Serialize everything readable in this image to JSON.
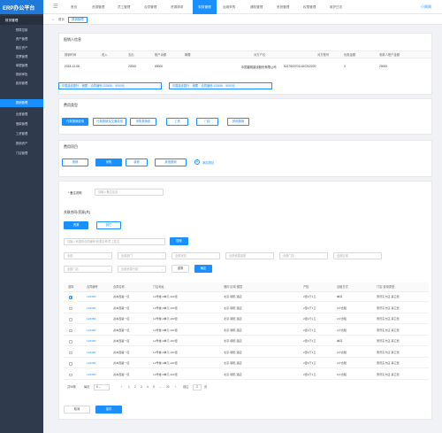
{
  "app": {
    "logo": "ERP办公平台",
    "user": "小周周"
  },
  "nav": [
    "首页",
    "资源管理",
    "员工管理",
    "合同管理",
    "资源请求",
    "财务管理",
    "运维采购",
    "通知管理",
    "系统管理",
    "权限管理",
    "维护日志"
  ],
  "sidebar": {
    "head": "财务管理",
    "items": [
      "预算控制",
      "资产管理",
      "固定资产",
      "发票管理",
      "单据管理",
      "报销审批",
      "费用管理",
      "报销管理",
      "出差管理",
      "借款管理",
      "工资管理",
      "报销资产",
      "门店管理"
    ]
  },
  "breadcrumb": {
    "home": "首页",
    "tab": "报销管理"
  },
  "summary": {
    "title": "报销人信息",
    "headers": [
      "报销时间",
      "收入",
      "支出",
      "账户余额",
      "摘要",
      "对方户名",
      "对方账号",
      "优惠金额",
      "收款人账户金额"
    ],
    "values": [
      "2018-12-08",
      "",
      "20000",
      "69000",
      "",
      "中国建筑建设股份有限公司",
      "62176007011447202200",
      "0",
      "20000"
    ],
    "tags": [
      {
        "bank": "中国建设银行",
        "type": "储蓄",
        "account": "合同编号:123456",
        "amount": "5000元"
      },
      {
        "bank": "中国建设银行",
        "type": "储蓄",
        "account": "合同编号:123456",
        "amount": "5000元"
      }
    ]
  },
  "expense_type": {
    "title": "费用类型",
    "options": [
      "代报报销费用",
      "代报报销及交通费用",
      "采购报销费",
      "工资",
      "门店",
      "其他报销"
    ]
  },
  "expense_item": {
    "title": "费用项目",
    "options": [
      "报销",
      "采购",
      "装修",
      "其他报销",
      "其他项目"
    ],
    "add_label": "添加项目"
  },
  "remark": {
    "label": "* 备注说明",
    "placeholder": "请输入备注信息"
  },
  "related": {
    "title": "关联合同/资源(共)",
    "tabs": [
      "资源",
      "其它"
    ],
    "search_placeholder": "请输入资源的合同编号/资源名称/员工姓名",
    "search_btn": "搜索",
    "filters": [
      "全部",
      "全部部门",
      "全部状态",
      "全部资源类型",
      "全部门店",
      "全部区域",
      "全部门店",
      "全部资源分类"
    ],
    "reset": "重置",
    "confirm": "确定"
  },
  "table": {
    "headers": [
      "选择",
      "合同编号",
      "合同名称",
      "门店地址",
      "储存·区域·楼层",
      "产权",
      "合租方式",
      "门店·费用类型"
    ],
    "rows": [
      {
        "code": "123456",
        "name": "资本西路一区",
        "addr": "12号楼-2单元-202室",
        "floor": "北京·朝阳·酒店",
        "prop": "2室1厅1卫",
        "mode": "单间",
        "type": "惠普东方店·其它费"
      },
      {
        "code": "123456",
        "name": "资本西路一区",
        "addr": "12号楼-2单元-202室",
        "floor": "北京·朝阳·酒店",
        "prop": "2室1厅1卫",
        "mode": "2户合租",
        "type": "惠普东方店·其它费"
      },
      {
        "code": "123456",
        "name": "资本西路一区",
        "addr": "12号楼-2单元-202室",
        "floor": "北京·朝阳·酒店",
        "prop": "2室1厅1卫",
        "mode": "2户合租",
        "type": "惠普东方店·其它费"
      },
      {
        "code": "123456",
        "name": "资本西路一区",
        "addr": "12号楼-2单元-202室",
        "floor": "北京·朝阳·酒店",
        "prop": "2室1厅1卫",
        "mode": "2户合租",
        "type": "惠普东方店·其它费"
      },
      {
        "code": "123456",
        "name": "资本西路一区",
        "addr": "12号楼-2单元-202室",
        "floor": "北京·朝阳·酒店",
        "prop": "2室1厅1卫",
        "mode": "单间",
        "type": "惠普东方店·其它费"
      },
      {
        "code": "123456",
        "name": "资本西路一区",
        "addr": "12号楼-2单元-202室",
        "floor": "北京·朝阳·酒店",
        "prop": "2室1厅1卫",
        "mode": "2户合租",
        "type": "惠普东方店·其它费"
      },
      {
        "code": "123456",
        "name": "资本西路一区",
        "addr": "12号楼-2单元-202室",
        "floor": "北京·朝阳·酒店",
        "prop": "2室1厅1卫",
        "mode": "2户合租",
        "type": "惠普东方店·其它费"
      },
      {
        "code": "123456",
        "name": "资本西路一区",
        "addr": "12号楼-2单元-202室",
        "floor": "北京·朝阳·酒店",
        "prop": "2室1厅1卫",
        "mode": "2户合租",
        "type": "惠普东方店·其它费"
      }
    ]
  },
  "pagination": {
    "total": "共98条",
    "page_size": "每页",
    "size": "8",
    "prev": "‹",
    "pages": [
      "1",
      "2",
      "3",
      "4",
      "5",
      "...",
      "20"
    ],
    "next": "›",
    "goto": "前往",
    "goto_val": "2",
    "page_unit": "页"
  },
  "footer": {
    "cancel": "取消",
    "save": "保存"
  },
  "colors": {
    "primary": "#1890ff",
    "sidebar": "#2f3a4d"
  }
}
